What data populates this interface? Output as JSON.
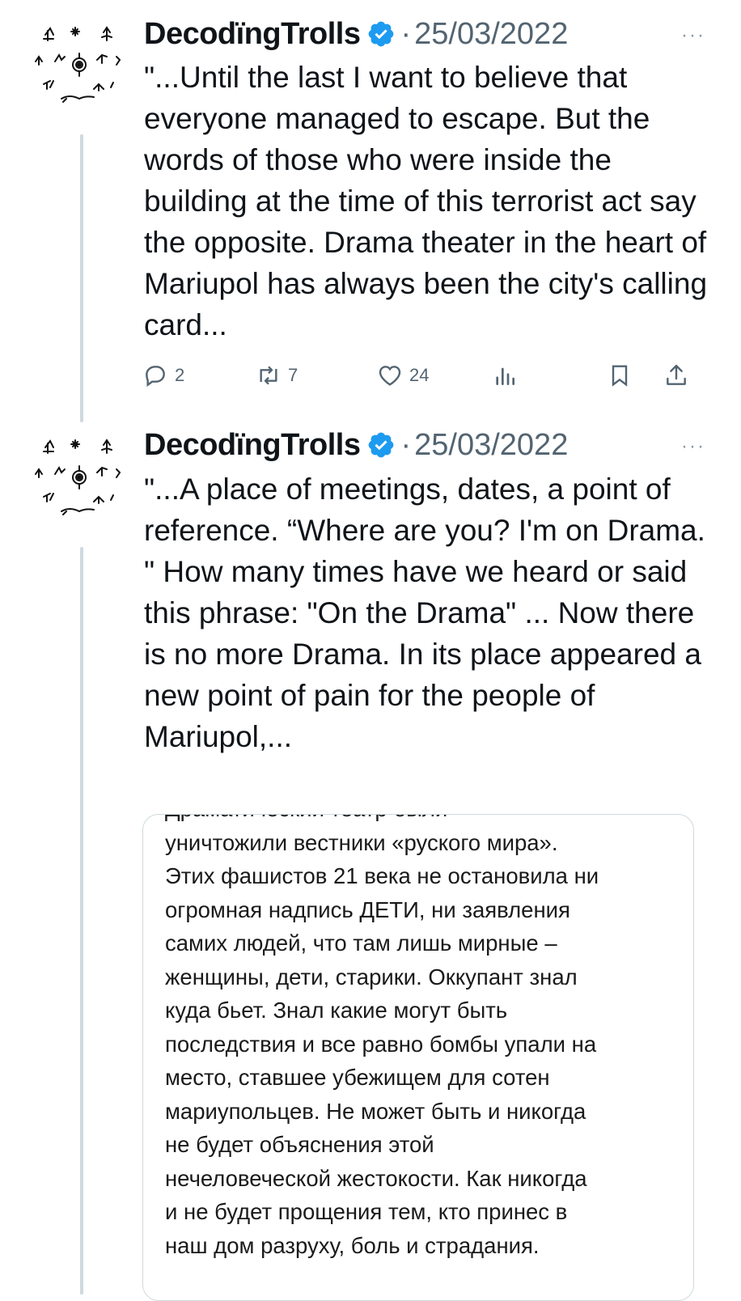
{
  "tweets": [
    {
      "author": "DecodïngTrolls",
      "separator": "·",
      "date": "25/03/2022",
      "more": "···",
      "text": "\"...Until the last I want to believe that everyone managed to escape. But the words of those who were inside the building at the time of this terrorist act say the opposite. Drama theater in the heart of Mariupol has always been the city's calling card...",
      "actions": {
        "replies": "2",
        "retweets": "7",
        "likes": "24"
      }
    },
    {
      "author": "DecodïngTrolls",
      "separator": "·",
      "date": "25/03/2022",
      "more": "···",
      "text": "\"...A place of meetings, dates, a point of reference. “Where are you? I'm on Drama. \" How many times have we heard or said this phrase: \"On the Drama\" ... Now there is no more Drama. In its place appeared a new point of pain for the people of Mariupol,..."
    }
  ],
  "embedded_image_text": {
    "cut_top_line": "Драматический театр были",
    "lines": [
      "уничтожили вестники «руского мира».",
      "Этих фашистов 21 века не остановила ни",
      "огромная надпись ДЕТИ, ни заявления",
      "самих людей, что там лишь мирные –",
      "женщины, дети, старики. Оккупант знал",
      "куда бьет. Знал какие могут быть",
      "последствия и все равно бомбы упали на",
      "место, ставшее убежищем для сотен",
      "мариупольцев. Не может быть и никогда",
      "не будет объяснения этой",
      "нечеловеческой жестокости. Как никогда",
      "и не будет прощения тем, кто принес в",
      "наш дом разруху, боль и страдания."
    ]
  },
  "icons": {
    "verified": "verified-badge-icon",
    "reply": "reply-icon",
    "retweet": "retweet-icon",
    "like": "heart-icon",
    "views": "views-icon",
    "bookmark": "bookmark-icon",
    "share": "share-icon",
    "more": "more-icon"
  },
  "colors": {
    "verified": "#1d9bf0",
    "text": "#0f1419",
    "secondary": "#536471",
    "thread_line": "#cfd9de"
  }
}
